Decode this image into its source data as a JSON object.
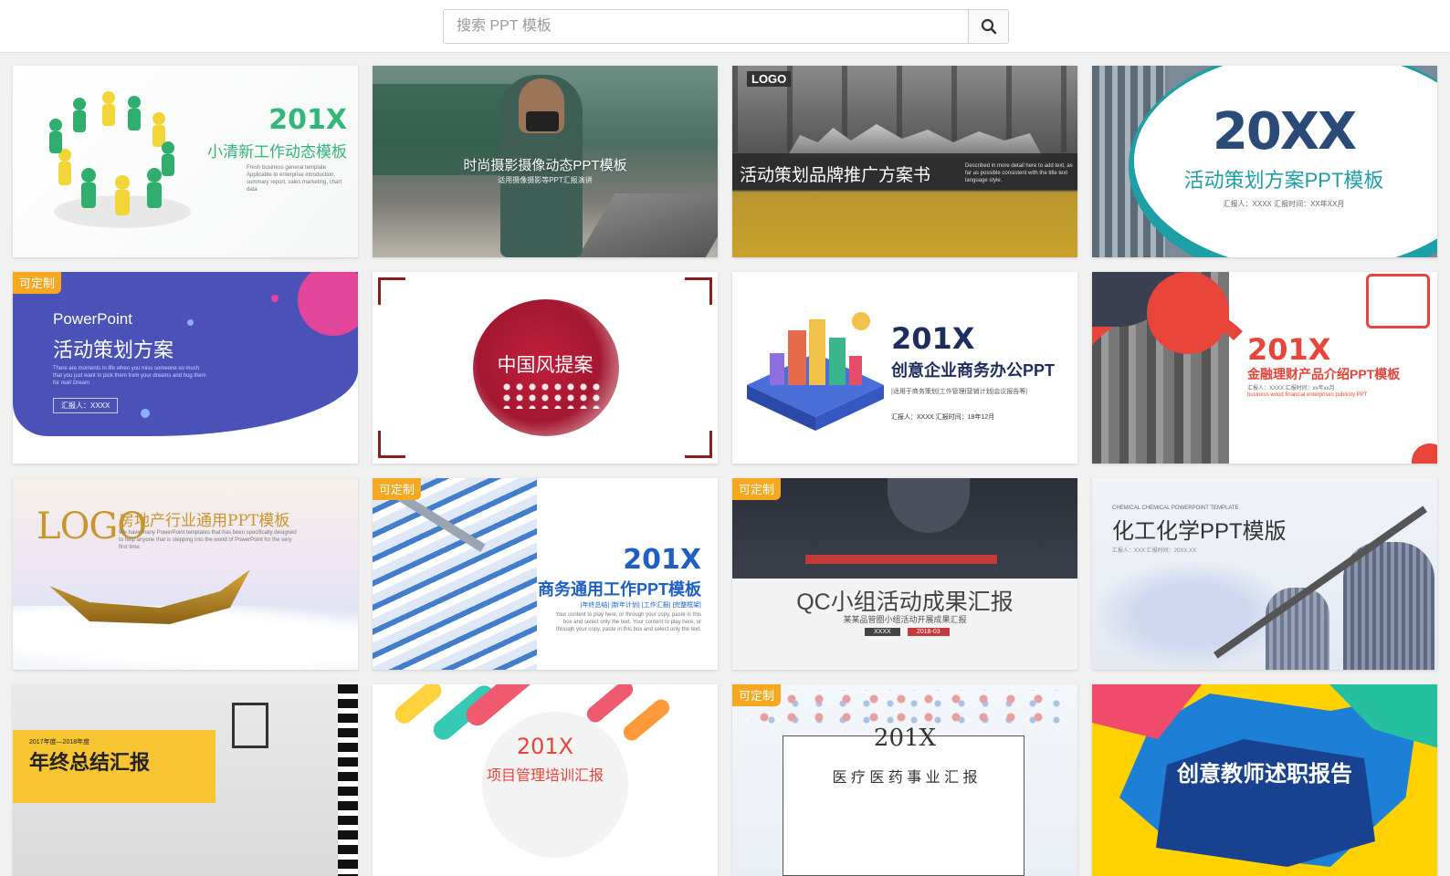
{
  "search": {
    "placeholder": "搜索 PPT 模板",
    "value": ""
  },
  "badge_label": "可定制",
  "cards": [
    {
      "big": "201X",
      "title": "小清新工作动态模板",
      "desc": "Fresh business general template Applicable to enterprise introduction, summary report, sales marketing, chart data"
    },
    {
      "title": "时尚摄影摄像动态PPT模板",
      "sub": "适用摄像摄影等PPT汇报演讲"
    },
    {
      "logo": "LOGO",
      "title": "活动策划品牌推广方案书",
      "desc": "Described in more detail here to add text, as far as possible consistent with the title text language style."
    },
    {
      "big": "20XX",
      "title": "活动策划方案PPT模板",
      "meta": "汇报人：XXXX    汇报时间：XX年XX月"
    },
    {
      "badge": true,
      "en": "PowerPoint",
      "title": "活动策划方案",
      "desc": "There are moments in life when you miss someone so much that you just want to pick them from your dreams and hug them for real! Dream",
      "reporter": "汇报人：XXXX"
    },
    {
      "title": "中国风提案"
    },
    {
      "big": "201X",
      "title": "创意企业商务办公PPT",
      "sub": "|适用于商务策划|工作管理|营销计划|会议报告等|",
      "meta": "汇报人：XXXX    汇报时间：18年12月"
    },
    {
      "big": "201X",
      "title": "金融理财产品介绍PPT模板",
      "meta": "汇报人：XXXX    汇报时间：xx年xx月",
      "sub": "business wood financial enterprises publicity PPT"
    },
    {
      "logo": "LOGO",
      "title": "房地产行业通用PPT模板",
      "desc": "We have many PowerPoint templates that has been specifically designed to help anyone that is stepping into the world of PowerPoint for the very first time."
    },
    {
      "badge": true,
      "big": "201X",
      "title": "商务通用工作PPT模板",
      "sub": "|年终总结| |新年计划| |工作汇报| |完整框架|",
      "desc": "Your content to play here, or through your copy, paste in this box and select only the text. Your content to play here, or through your copy, paste in this box and select only the text."
    },
    {
      "badge": true,
      "title": "QC小组活动成果汇报",
      "sub": "某某品管圈小组活动开展成果汇报",
      "meta1": "XXXX",
      "meta2": "2018-03"
    },
    {
      "en": "CHEMICAL CHEMICAL POWERPOINT TEMPLATE",
      "title": "化工化学PPT模版",
      "meta": "汇报人：XXX    汇报时间：20XX.XX"
    },
    {
      "tag": "2017年度—2018年度",
      "title": "年终总结汇报"
    },
    {
      "big": "201X",
      "title": "项目管理培训汇报"
    },
    {
      "badge": true,
      "big": "201X",
      "title": "医 疗 医 药 事 业 汇 报"
    },
    {
      "title": "创意教师述职报告"
    }
  ]
}
